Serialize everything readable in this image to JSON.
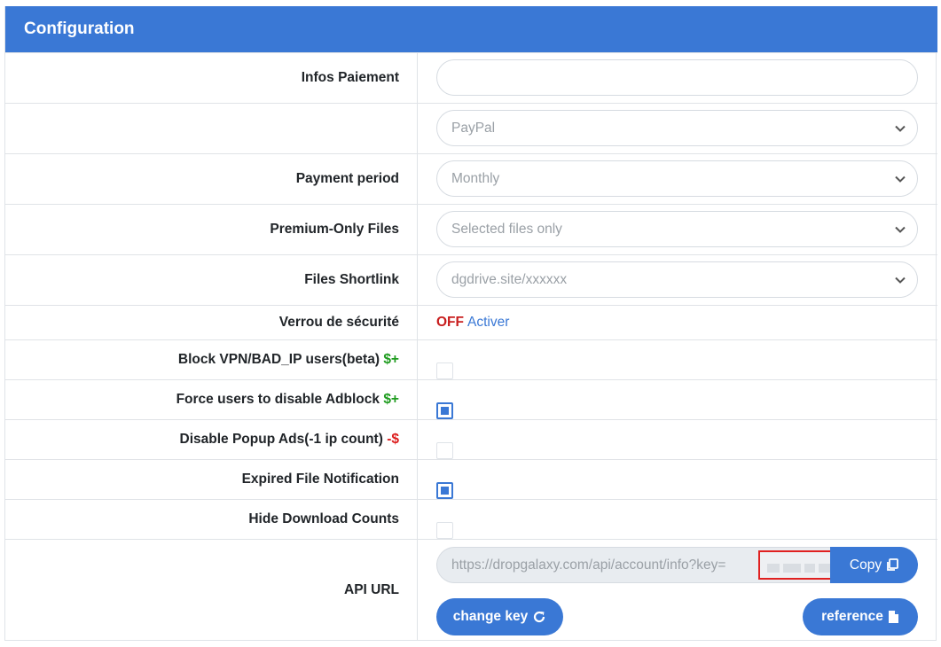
{
  "header": {
    "title": "Configuration"
  },
  "rows": {
    "infos_paiement": {
      "label": "Infos Paiement",
      "value": ""
    },
    "payment_method": {
      "label": "",
      "value": "PayPal"
    },
    "payment_period": {
      "label": "Payment period",
      "value": "Monthly"
    },
    "premium_only": {
      "label": "Premium-Only Files",
      "value": "Selected files only"
    },
    "shortlink": {
      "label": "Files Shortlink",
      "value": "dgdrive.site/xxxxxx"
    },
    "security_lock": {
      "label": "Verrou de sécurité",
      "status": "OFF",
      "action": "Activer"
    },
    "block_vpn": {
      "label": "Block VPN/BAD_IP users(beta)",
      "tag": "$+",
      "checked": false
    },
    "force_adblock": {
      "label": "Force users to disable Adblock",
      "tag": "$+",
      "checked": true
    },
    "disable_popup": {
      "label": "Disable Popup Ads(-1 ip count)",
      "tag": "-$",
      "checked": false
    },
    "expired_notification": {
      "label": "Expired File Notification",
      "checked": true
    },
    "hide_counts": {
      "label": "Hide Download Counts",
      "checked": false
    },
    "api_url": {
      "label": "API URL",
      "value": "https://dropgalaxy.com/api/account/info?key=",
      "copy_label": "Copy",
      "change_key_label": "change key",
      "reference_label": "reference"
    }
  },
  "colors": {
    "accent": "#3a78d5",
    "green_tag": "#1e9b1e",
    "red_tag": "#dc1d1d",
    "off_status": "#c81e1e"
  },
  "icons": {
    "select": "chevron-down-icon",
    "copy": "copy-icon",
    "change_key": "refresh-icon",
    "reference": "file-icon"
  }
}
